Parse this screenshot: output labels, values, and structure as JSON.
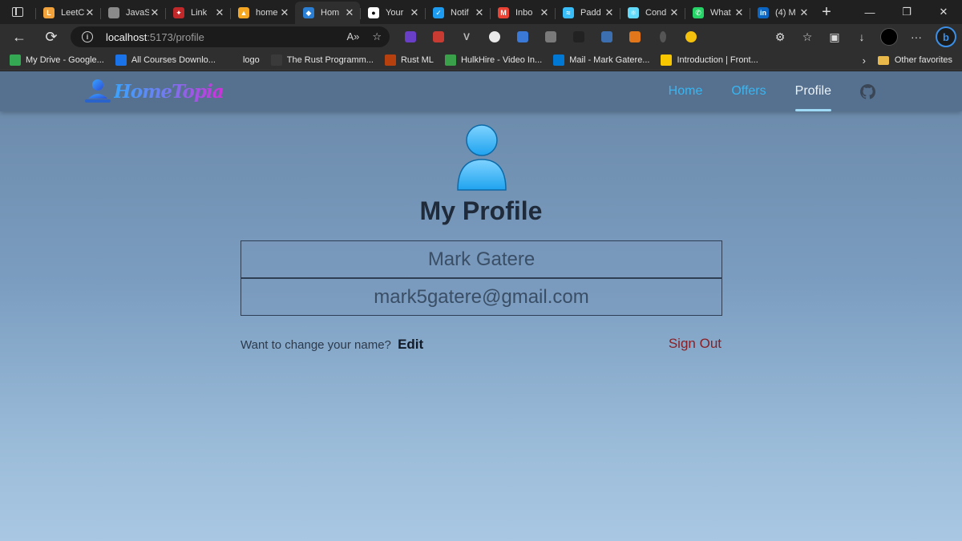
{
  "browser": {
    "tabs": [
      {
        "label": "LeetC",
        "icon": "leetcode-icon",
        "color": "#f2a23a",
        "glyph": "L"
      },
      {
        "label": "JavaS",
        "icon": "javascript-thumb-icon",
        "color": "#8a8a8a",
        "glyph": ""
      },
      {
        "label": "Link",
        "icon": "link-icon",
        "color": "#c0282a",
        "glyph": "✦"
      },
      {
        "label": "home",
        "icon": "firebase-icon",
        "color": "#f5a623",
        "glyph": "▲"
      },
      {
        "label": "Hom",
        "icon": "hometopia-icon",
        "color": "#2a7fd4",
        "glyph": "◆",
        "active": true
      },
      {
        "label": "Your",
        "icon": "github-icon",
        "color": "#ffffff",
        "glyph": "●"
      },
      {
        "label": "Notif",
        "icon": "twitter-icon",
        "color": "#1d9bf0",
        "glyph": "✓"
      },
      {
        "label": "Inbo",
        "icon": "gmail-icon",
        "color": "#ea4335",
        "glyph": "M"
      },
      {
        "label": "Padd",
        "icon": "tailwind-icon",
        "color": "#38bdf8",
        "glyph": "≈"
      },
      {
        "label": "Cond",
        "icon": "react-icon",
        "color": "#61dafb",
        "glyph": "⚛"
      },
      {
        "label": "What",
        "icon": "whatsapp-icon",
        "color": "#25d366",
        "glyph": "✆"
      },
      {
        "label": "(4) M",
        "icon": "linkedin-icon",
        "color": "#0a66c2",
        "glyph": "in"
      }
    ],
    "url_host": "localhost",
    "url_path": ":5173/profile",
    "bookmarks": [
      {
        "label": "My Drive - Google...",
        "icon": "google-drive-icon",
        "color": "#34a853"
      },
      {
        "label": "All Courses Downlo...",
        "icon": "courses-icon",
        "color": "#1a73e8"
      },
      {
        "label": "logo",
        "icon": "page-icon",
        "color": "#2f2f2f"
      },
      {
        "label": "The Rust Programm...",
        "icon": "rust-book-icon",
        "color": "#3a3a3a"
      },
      {
        "label": "Rust ML",
        "icon": "rust-ml-icon",
        "color": "#b7410e"
      },
      {
        "label": "HulkHire - Video In...",
        "icon": "hulkhire-icon",
        "color": "#3aa04a"
      },
      {
        "label": "Mail - Mark Gatere...",
        "icon": "outlook-icon",
        "color": "#0078d4"
      },
      {
        "label": "Introduction | Front...",
        "icon": "frontend-icon",
        "color": "#f7c600"
      }
    ],
    "other_favorites": "Other favorites"
  },
  "app": {
    "logo_text": "HomeTopia",
    "nav": {
      "home": "Home",
      "offers": "Offers",
      "profile": "Profile"
    },
    "page_title": "My Profile",
    "profile": {
      "name": "Mark Gatere",
      "email": "mark5gatere@gmail.com"
    },
    "change_prompt": "Want to change your name?",
    "edit_label": "Edit",
    "signout_label": "Sign Out"
  }
}
